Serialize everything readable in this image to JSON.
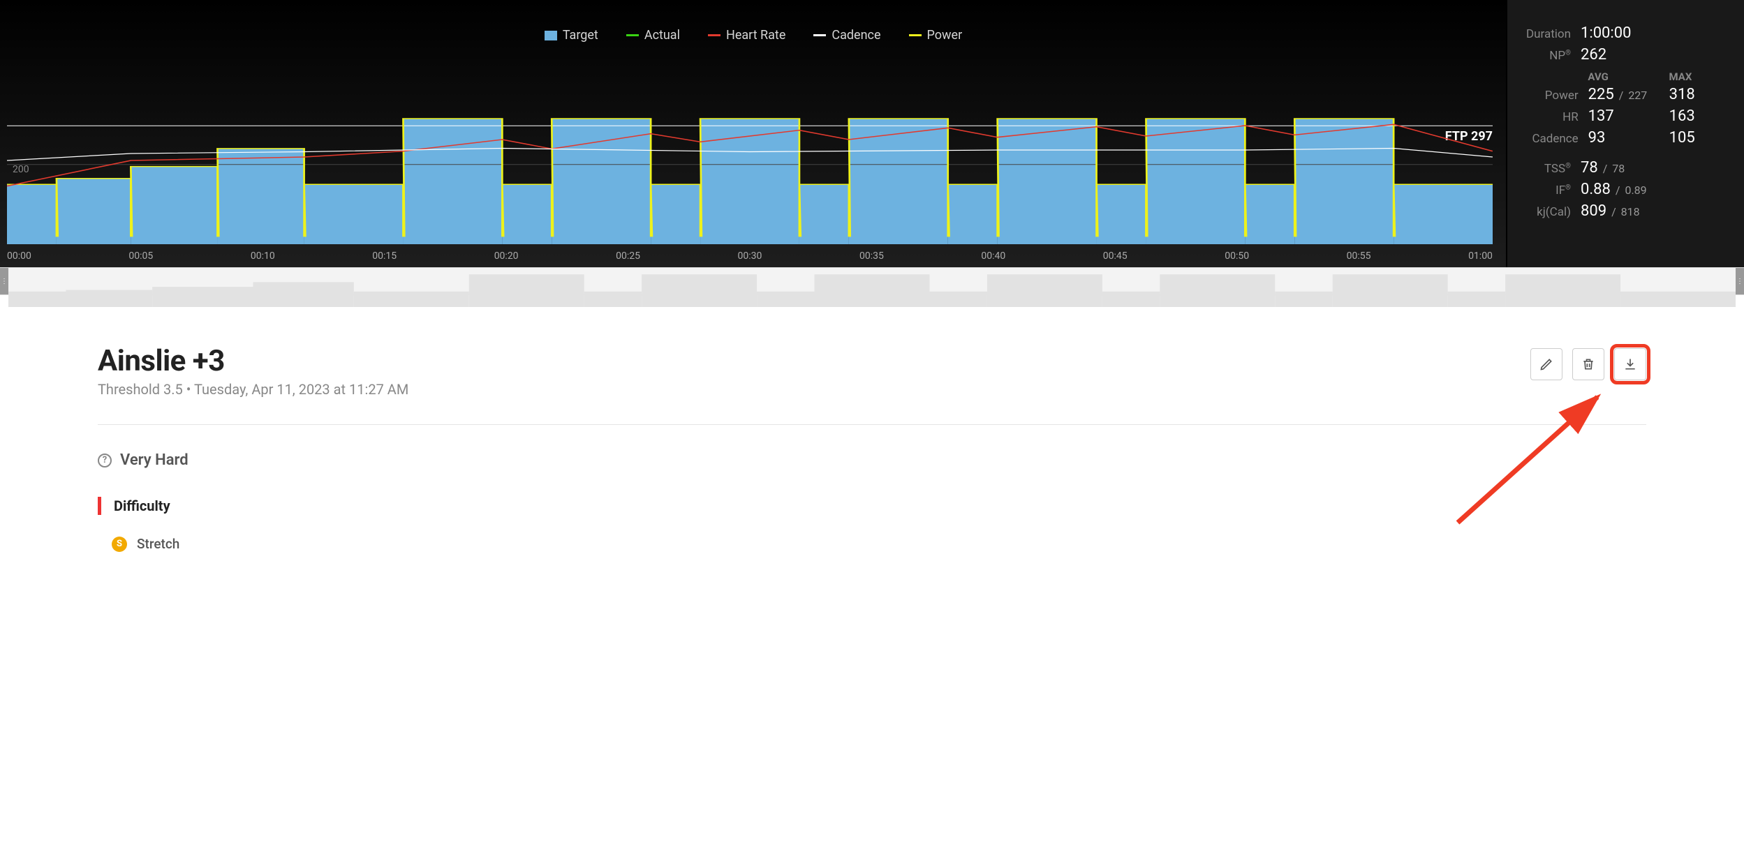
{
  "legend": {
    "target": "Target",
    "actual": "Actual",
    "hr": "Heart Rate",
    "cadence": "Cadence",
    "power": "Power"
  },
  "colors": {
    "target": "#6db2e0",
    "actual": "#39d312",
    "hr": "#e23a2e",
    "cadence": "#ffffff",
    "power": "#eef21b"
  },
  "chart": {
    "y_tick": "200",
    "ftp_label": "FTP 297",
    "x_ticks": [
      "00:00",
      "00:05",
      "00:10",
      "00:15",
      "00:20",
      "00:25",
      "00:30",
      "00:35",
      "00:40",
      "00:45",
      "00:50",
      "00:55",
      "01:00"
    ]
  },
  "stats": {
    "duration_label": "Duration",
    "duration_value": "1:00:00",
    "np_label": "NP",
    "np_value": "262",
    "avg_head": "AVG",
    "max_head": "MAX",
    "power_label": "Power",
    "power_avg": "225",
    "power_avg_goal": "227",
    "power_max": "318",
    "hr_label": "HR",
    "hr_avg": "137",
    "hr_max": "163",
    "cad_label": "Cadence",
    "cad_avg": "93",
    "cad_max": "105",
    "tss_label": "TSS",
    "tss_val": "78",
    "tss_goal": "78",
    "if_label": "IF",
    "if_val": "0.88",
    "if_goal": "0.89",
    "kj_label": "kj(Cal)",
    "kj_val": "809",
    "kj_goal": "818"
  },
  "workout": {
    "title": "Ainslie +3",
    "subtitle": "Threshold 3.5 • Tuesday, Apr 11, 2023 at 11:27 AM",
    "very_hard": "Very Hard",
    "difficulty": "Difficulty",
    "stretch": "Stretch",
    "stretch_badge": "S"
  },
  "chart_data": {
    "type": "step-area+lines",
    "x_unit": "minutes",
    "x_range": [
      0,
      60
    ],
    "ftp": 297,
    "gridlines_y": [
      200
    ],
    "target_power_intervals": [
      {
        "start": 0.0,
        "end": 2.0,
        "watts": 150
      },
      {
        "start": 2.0,
        "end": 5.0,
        "watts": 165
      },
      {
        "start": 5.0,
        "end": 8.5,
        "watts": 195
      },
      {
        "start": 8.5,
        "end": 12.0,
        "watts": 240
      },
      {
        "start": 12.0,
        "end": 16.0,
        "watts": 150
      },
      {
        "start": 16.0,
        "end": 20.0,
        "watts": 315
      },
      {
        "start": 20.0,
        "end": 22.0,
        "watts": 150
      },
      {
        "start": 22.0,
        "end": 26.0,
        "watts": 315
      },
      {
        "start": 26.0,
        "end": 28.0,
        "watts": 150
      },
      {
        "start": 28.0,
        "end": 32.0,
        "watts": 315
      },
      {
        "start": 32.0,
        "end": 34.0,
        "watts": 150
      },
      {
        "start": 34.0,
        "end": 38.0,
        "watts": 315
      },
      {
        "start": 38.0,
        "end": 40.0,
        "watts": 150
      },
      {
        "start": 40.0,
        "end": 44.0,
        "watts": 315
      },
      {
        "start": 44.0,
        "end": 46.0,
        "watts": 150
      },
      {
        "start": 46.0,
        "end": 50.0,
        "watts": 315
      },
      {
        "start": 50.0,
        "end": 52.0,
        "watts": 150
      },
      {
        "start": 52.0,
        "end": 56.0,
        "watts": 315
      },
      {
        "start": 56.0,
        "end": 60.0,
        "watts": 150
      }
    ],
    "series": [
      {
        "name": "Actual Power",
        "color": "power",
        "note": "Tracks target closely; noisy with brief dropouts to ~0 at interval transitions."
      },
      {
        "name": "Heart Rate",
        "color": "hr",
        "approx_points": [
          {
            "t": 0,
            "v": 110
          },
          {
            "t": 5,
            "v": 132
          },
          {
            "t": 12,
            "v": 135
          },
          {
            "t": 16,
            "v": 140
          },
          {
            "t": 20,
            "v": 150
          },
          {
            "t": 22,
            "v": 142
          },
          {
            "t": 26,
            "v": 155
          },
          {
            "t": 28,
            "v": 148
          },
          {
            "t": 32,
            "v": 158
          },
          {
            "t": 34,
            "v": 150
          },
          {
            "t": 38,
            "v": 160
          },
          {
            "t": 40,
            "v": 152
          },
          {
            "t": 44,
            "v": 161
          },
          {
            "t": 46,
            "v": 153
          },
          {
            "t": 50,
            "v": 162
          },
          {
            "t": 52,
            "v": 154
          },
          {
            "t": 56,
            "v": 163
          },
          {
            "t": 60,
            "v": 140
          }
        ]
      },
      {
        "name": "Cadence",
        "color": "cadence",
        "approx_points": [
          {
            "t": 0,
            "v": 88
          },
          {
            "t": 5,
            "v": 92
          },
          {
            "t": 12,
            "v": 93
          },
          {
            "t": 20,
            "v": 95
          },
          {
            "t": 30,
            "v": 93
          },
          {
            "t": 40,
            "v": 94
          },
          {
            "t": 50,
            "v": 94
          },
          {
            "t": 56,
            "v": 95
          },
          {
            "t": 60,
            "v": 90
          }
        ]
      }
    ]
  }
}
